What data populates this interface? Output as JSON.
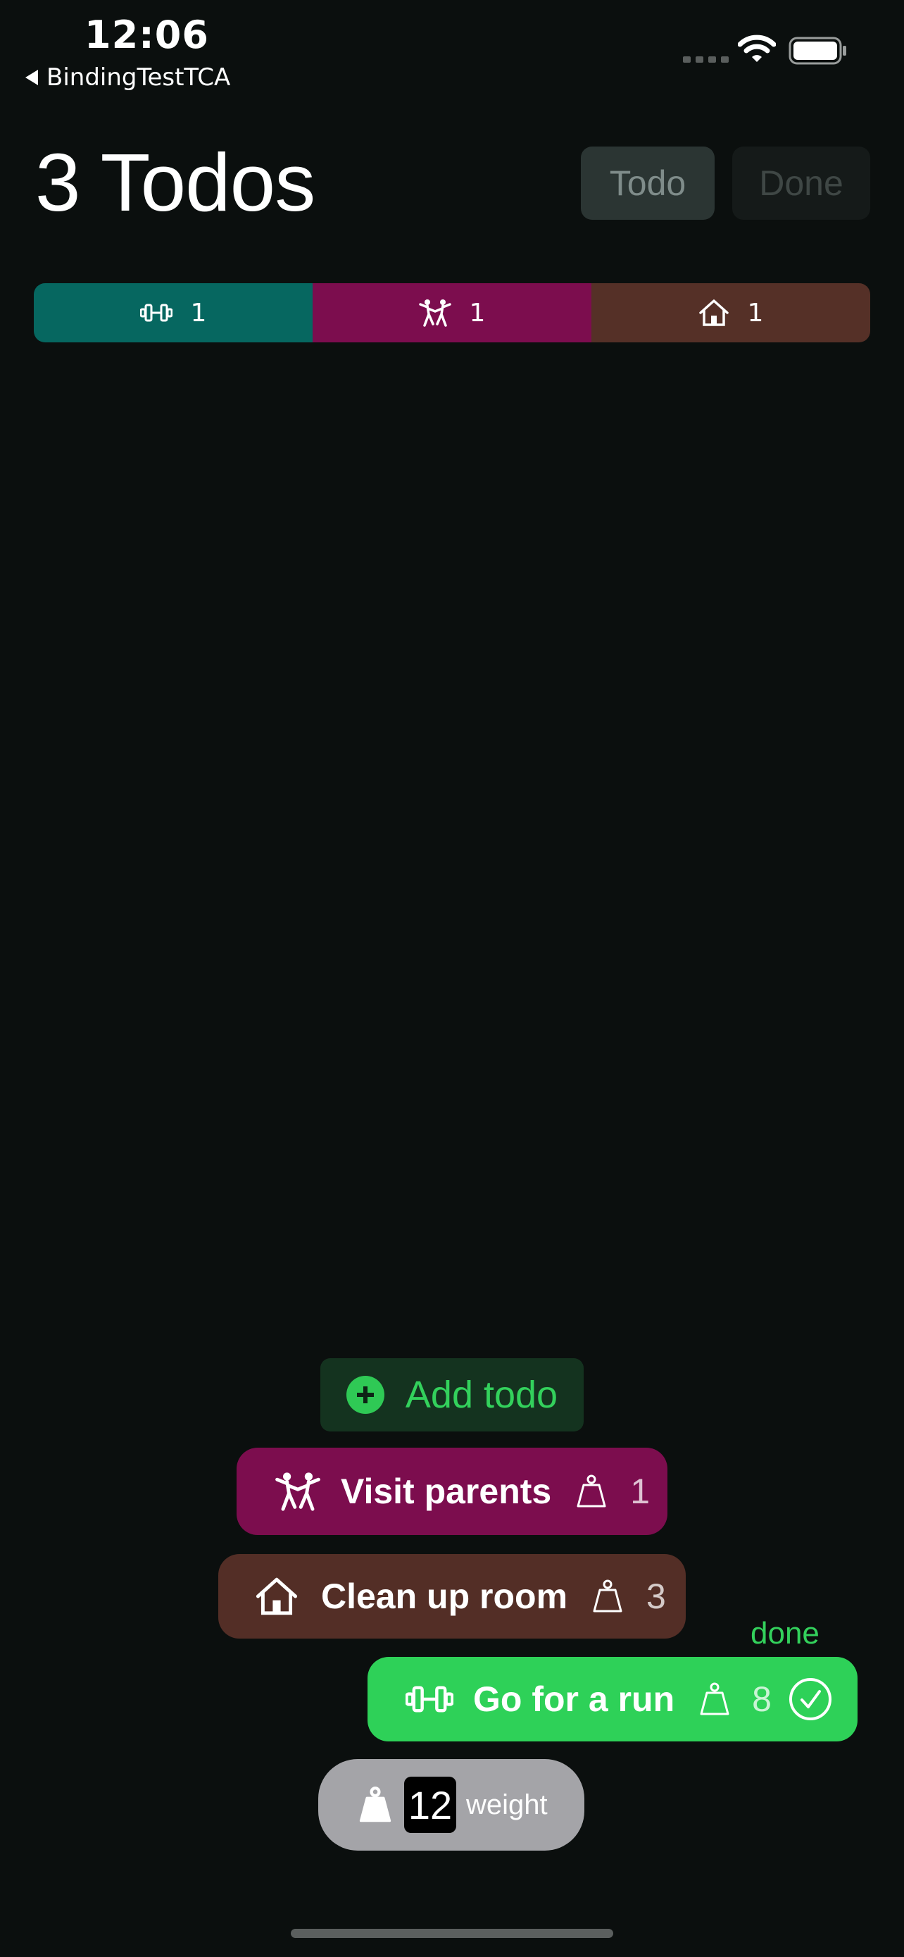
{
  "status_bar": {
    "time": "12:06",
    "back_app": "BindingTestTCA"
  },
  "header": {
    "title": "3 Todos",
    "filter_todo": "Todo",
    "filter_done": "Done"
  },
  "categories": [
    {
      "icon": "dumbbell-icon",
      "count": "1",
      "color": "#066760"
    },
    {
      "icon": "dancing-people-icon",
      "count": "1",
      "color": "#7c0d4e"
    },
    {
      "icon": "house-icon",
      "count": "1",
      "color": "#553027"
    }
  ],
  "add_button": {
    "label": "Add todo"
  },
  "todos": [
    {
      "title": "Visit parents",
      "icon": "dancing-people-icon",
      "weight": "1",
      "color": "#7c0d4e"
    },
    {
      "title": "Clean up room",
      "icon": "house-icon",
      "weight": "3",
      "color": "#532e26"
    },
    {
      "title": "Go for a run",
      "icon": "dumbbell-icon",
      "weight": "8",
      "color": "#2ed158",
      "status": "done"
    }
  ],
  "weight_picker": {
    "value": "12",
    "label": "weight"
  }
}
